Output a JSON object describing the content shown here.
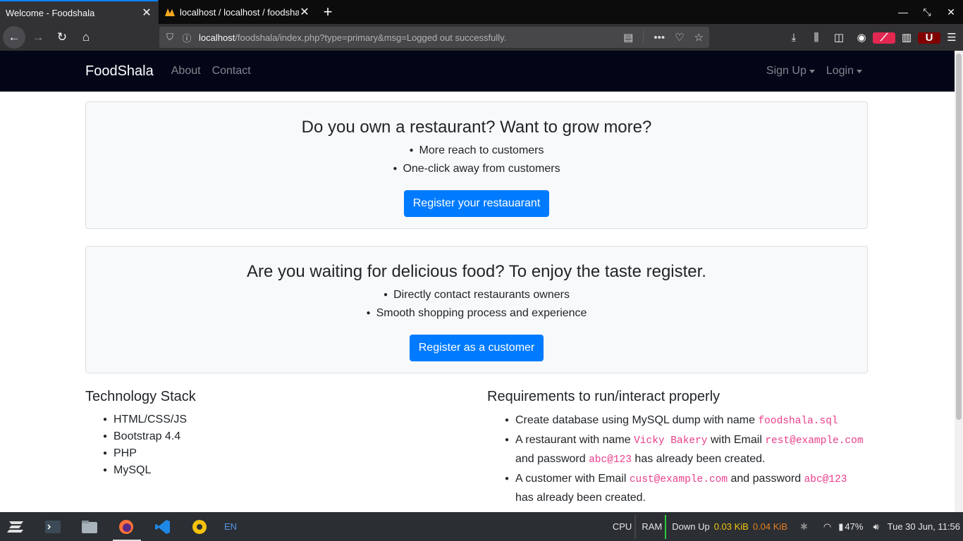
{
  "browser": {
    "tabs": [
      {
        "title": "Welcome - Foodshala",
        "active": true
      },
      {
        "title": "localhost / localhost / foodshala",
        "active": false
      }
    ],
    "url_host": "localhost",
    "url_path": "/foodshala/index.php?type=primary&msg=Logged out successfully."
  },
  "site": {
    "brand": "FoodShala",
    "nav": [
      {
        "label": "About"
      },
      {
        "label": "Contact"
      }
    ],
    "dropdowns": [
      {
        "label": "Sign Up"
      },
      {
        "label": "Login"
      }
    ]
  },
  "restaurant_card": {
    "heading": "Do you own a restaurant? Want to grow more?",
    "points": [
      "More reach to customers",
      "One-click away from customers"
    ],
    "button": "Register your restauarant"
  },
  "customer_card": {
    "heading": "Are you waiting for delicious food? To enjoy the taste register.",
    "points": [
      "Directly contact restaurants owners",
      "Smooth shopping process and experience"
    ],
    "button": "Register as a customer"
  },
  "tech_stack": {
    "heading": "Technology Stack",
    "items": [
      "HTML/CSS/JS",
      "Bootstrap 4.4",
      "PHP",
      "MySQL"
    ]
  },
  "requirements": {
    "heading": "Requirements to run/interact properly",
    "item1": {
      "pre": "Create database using MySQL dump with name ",
      "code": "foodshala.sql"
    },
    "item2": {
      "pre": "A restaurant with name ",
      "code1": "Vicky Bakery",
      "mid1": " with Email ",
      "code2": "rest@example.com",
      "mid2": " and password ",
      "code3": "abc@123",
      "post": " has already been created."
    },
    "item3": {
      "pre": "A customer with Email ",
      "code1": "cust@example.com",
      "mid": " and password ",
      "code2": "abc@123",
      "post": " has already been created."
    }
  },
  "taskbar": {
    "lang": "EN",
    "cpu": "CPU",
    "ram": "RAM",
    "net_label": "Down Up",
    "net_down": "0.03 KiB",
    "net_up": "0.04 KiB",
    "battery": "47%",
    "clock": "Tue 30 Jun, 11:56"
  },
  "colors": {
    "primary": "#007bff",
    "navbar": "#020617",
    "code": "#e83e8c"
  }
}
